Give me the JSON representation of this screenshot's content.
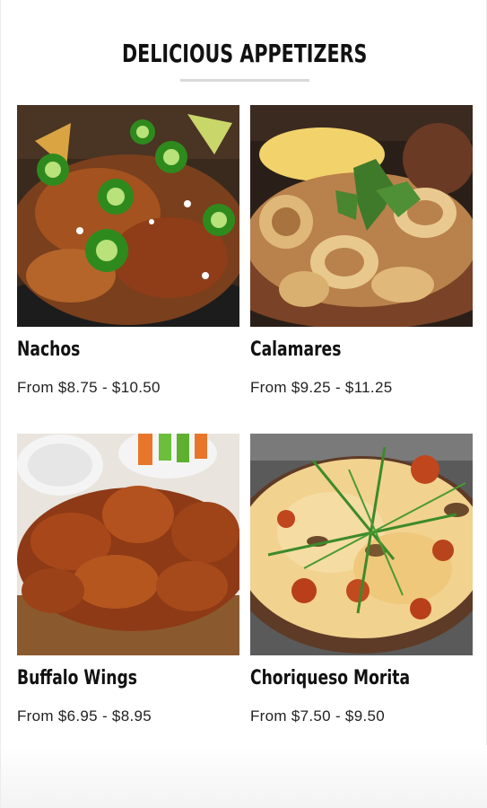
{
  "section": {
    "title": "DELICIOUS APPETIZERS"
  },
  "items": [
    {
      "name": "Nachos",
      "price": "From $8.75 - $10.50",
      "image": "nachos-photo"
    },
    {
      "name": "Calamares",
      "price": "From $9.25 - $11.25",
      "image": "calamares-photo"
    },
    {
      "name": "Buffalo Wings",
      "price": "From $6.95 - $8.95",
      "image": "buffalo-wings-photo"
    },
    {
      "name": "Choriqueso Morita",
      "price": "From $7.50 - $9.50",
      "image": "choriqueso-photo"
    }
  ]
}
